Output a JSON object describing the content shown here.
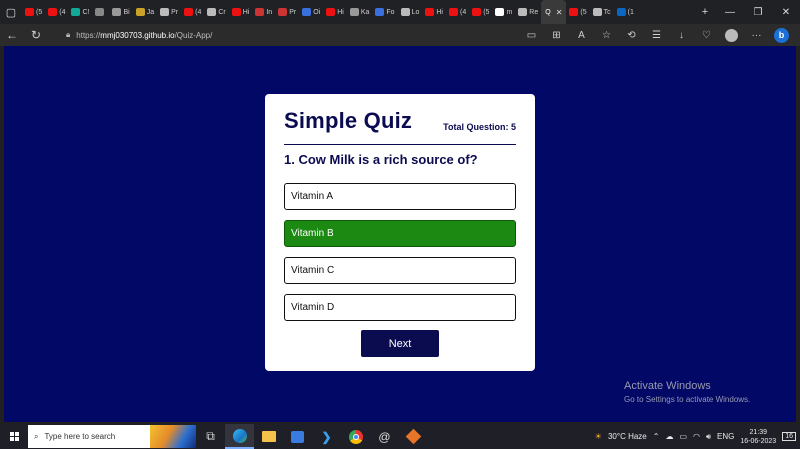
{
  "tabs": [
    {
      "label": "(5",
      "color": "#e11"
    },
    {
      "label": "(4",
      "color": "#e11"
    },
    {
      "label": "C!",
      "color": "#1a9"
    },
    {
      "label": "",
      "color": "#888"
    },
    {
      "label": "Bi",
      "color": "#999"
    },
    {
      "label": "Ja",
      "color": "#c9a227"
    },
    {
      "label": "Pr",
      "color": "#bbb"
    },
    {
      "label": "(4",
      "color": "#e11"
    },
    {
      "label": "Cr",
      "color": "#bbb"
    },
    {
      "label": "Hi",
      "color": "#e11"
    },
    {
      "label": "In",
      "color": "#c33"
    },
    {
      "label": "Pr",
      "color": "#c33"
    },
    {
      "label": "Oi",
      "color": "#3a6fe0"
    },
    {
      "label": "Hi",
      "color": "#e11"
    },
    {
      "label": "Ka",
      "color": "#999"
    },
    {
      "label": "Fo",
      "color": "#3a6fe0"
    },
    {
      "label": "Lo",
      "color": "#bbb"
    },
    {
      "label": "Hi",
      "color": "#e11"
    },
    {
      "label": "(4",
      "color": "#e11"
    },
    {
      "label": "(5",
      "color": "#e11"
    },
    {
      "label": "m",
      "color": "#fff"
    },
    {
      "label": "Re",
      "color": "#bbb"
    }
  ],
  "active_tab": {
    "label": "Q",
    "close": "✕"
  },
  "tabs_after": [
    {
      "label": "(5",
      "color": "#e11"
    },
    {
      "label": "Tc",
      "color": "#bbb"
    },
    {
      "label": "(1",
      "color": "#0a66c2"
    }
  ],
  "address": {
    "protocol": "https://",
    "host": "mmj030703.github.io",
    "path": "/Quiz-App/"
  },
  "quiz": {
    "title": "Simple Quiz",
    "total": "Total Question: 5",
    "question": "1. Cow Milk is a rich source of?",
    "answers": [
      "Vitamin A",
      "Vitamin B",
      "Vitamin C",
      "Vitamin D"
    ],
    "selected_index": 1,
    "next_label": "Next"
  },
  "colors": {
    "page_bg": "#010866",
    "accent": "#0b0c50",
    "correct": "#1c8a12"
  },
  "watermark": {
    "line1": "Activate Windows",
    "line2": "Go to Settings to activate Windows."
  },
  "taskbar": {
    "search_placeholder": "Type here to search",
    "weather": "30°C  Haze",
    "lang": "ENG",
    "time": "21:39",
    "date": "16-06-2023",
    "notifications": "16"
  }
}
